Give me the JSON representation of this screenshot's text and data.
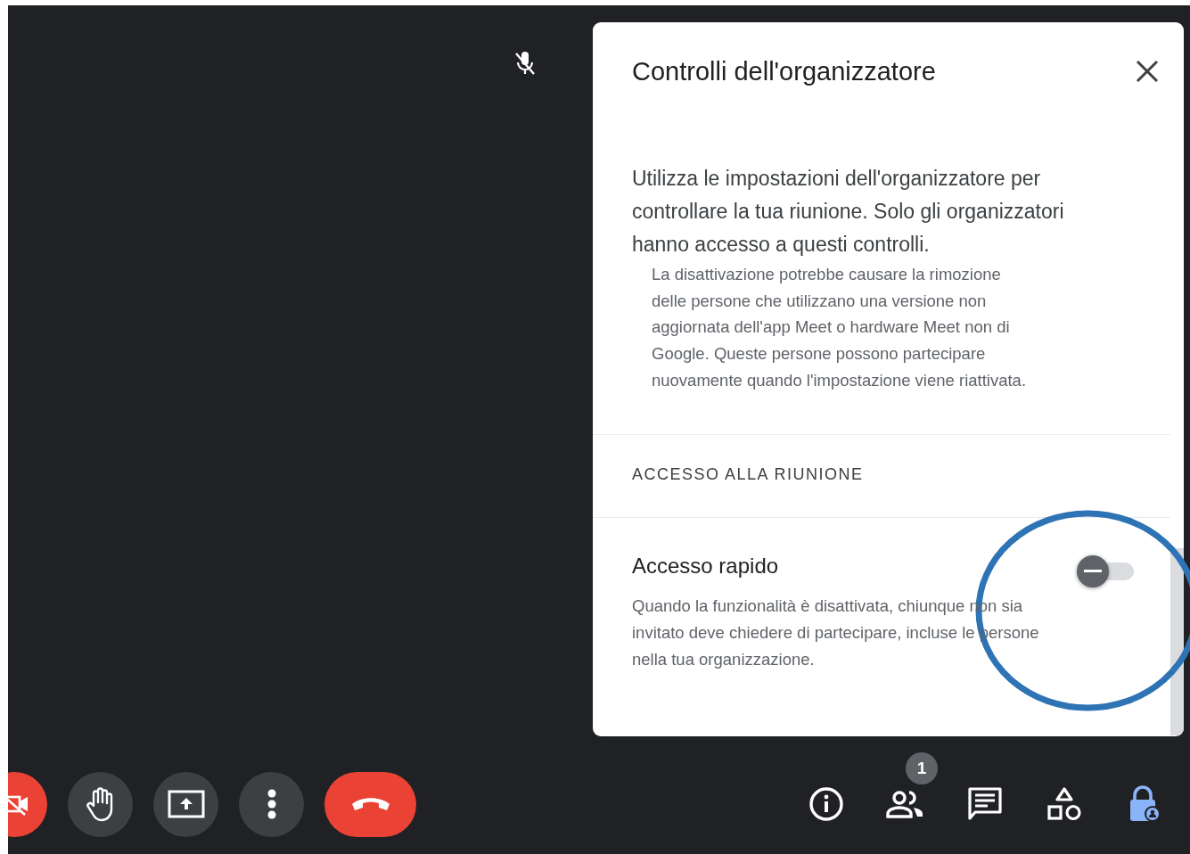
{
  "video_tile": {
    "muted": true
  },
  "panel": {
    "title": "Controlli dell'organizzatore",
    "intro": "Utilizza le impostazioni dell'organizzatore per controllare la tua riunione. Solo gli organizzatori hanno accesso a questi controlli.",
    "note": "La disattivazione potrebbe causare la rimozione delle persone che utilizzano una versione non aggiornata dell'app Meet o hardware Meet non di Google. Queste persone possono partecipare nuovamente quando l'impostazione viene riattivata.",
    "section_heading": "ACCESSO ALLA RIUNIONE",
    "settings": [
      {
        "label": "Accesso rapido",
        "description": "Quando la funzionalità è disattivata, chiunque non sia invitato deve chiedere di partecipare, incluse le persone nella tua organizzazione.",
        "on": false
      }
    ]
  },
  "left_controls": [
    {
      "kind": "camera",
      "off": true
    },
    {
      "kind": "hand"
    },
    {
      "kind": "present"
    },
    {
      "kind": "more"
    },
    {
      "kind": "end_call"
    }
  ],
  "right_tools": [
    {
      "kind": "info",
      "selected": false
    },
    {
      "kind": "people",
      "badge": "1",
      "selected": false
    },
    {
      "kind": "chat",
      "selected": false
    },
    {
      "kind": "activities",
      "selected": false
    },
    {
      "kind": "host_controls",
      "selected": true
    }
  ],
  "highlight_circle": true
}
